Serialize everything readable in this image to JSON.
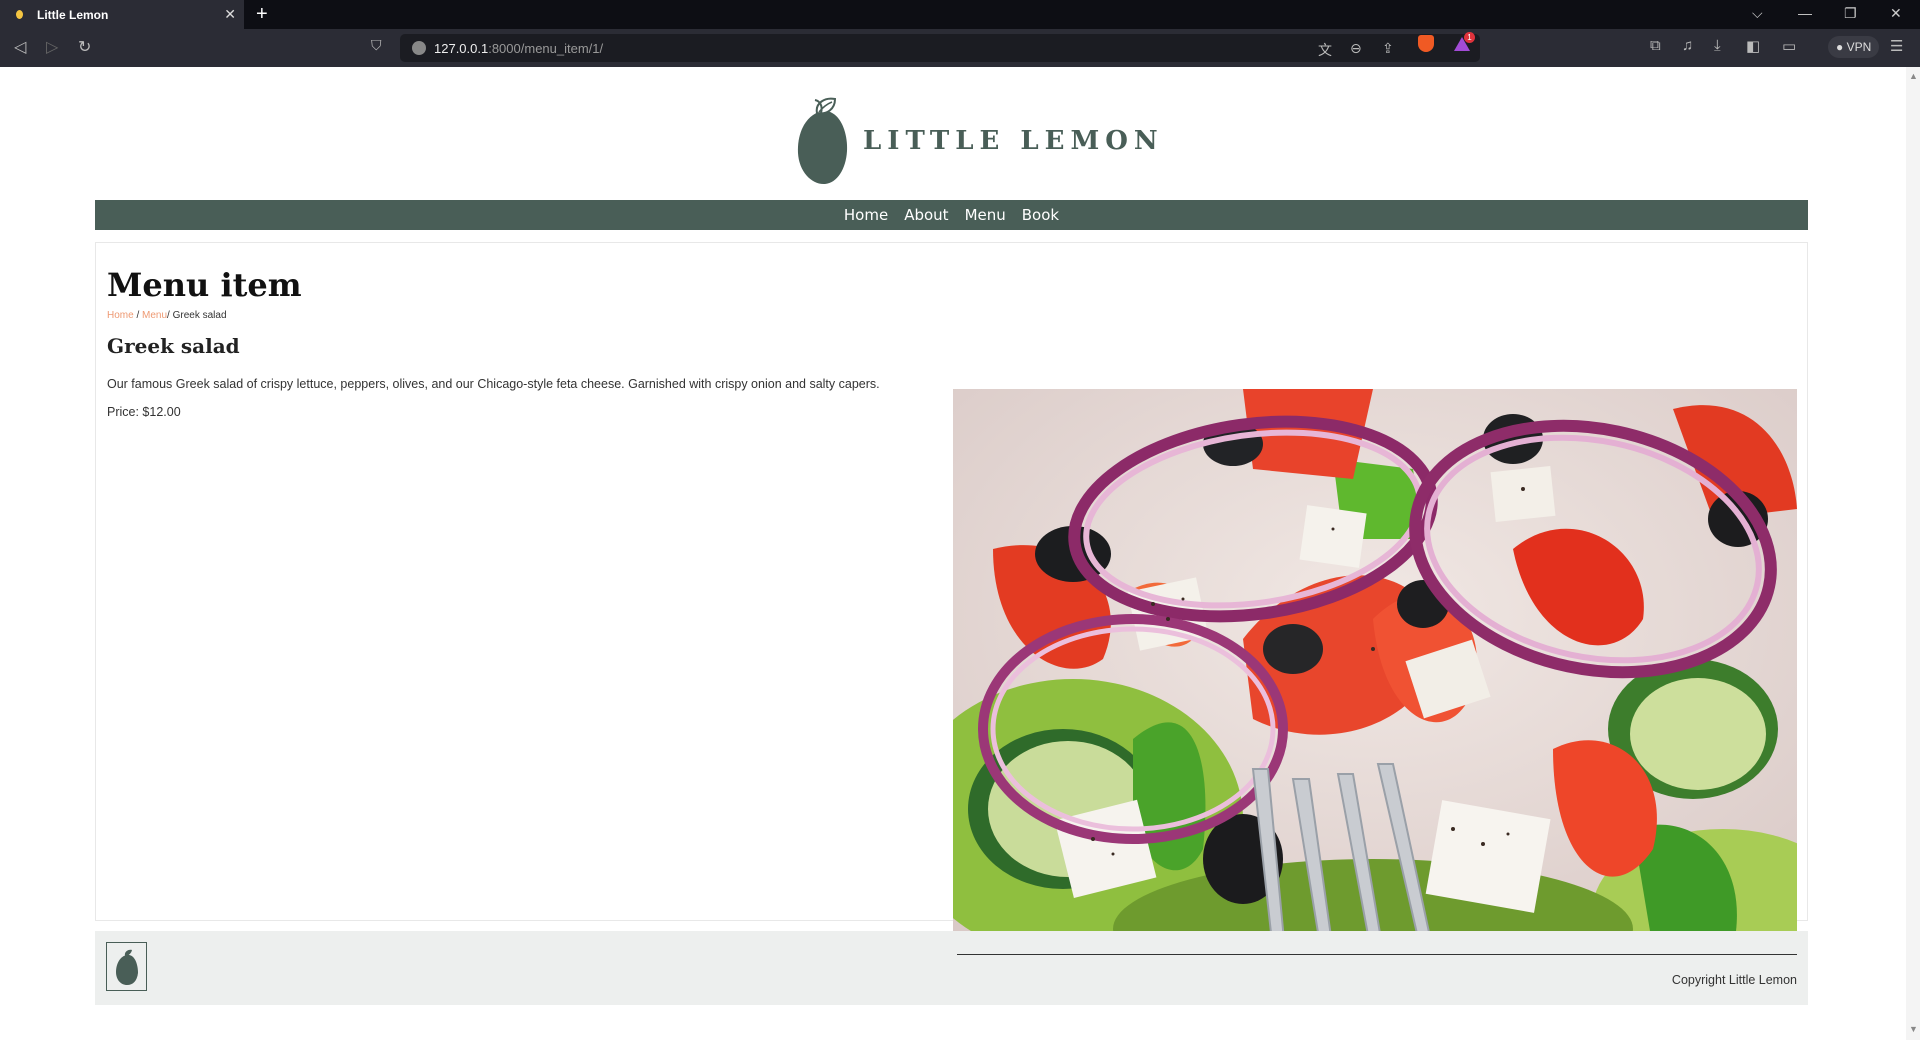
{
  "browser": {
    "tab_title": "Little Lemon",
    "tab_close": "✕",
    "new_tab": "+",
    "url_host": "127.0.0.1",
    "url_path": ":8000/menu_item/1/",
    "vpn_label": "VPN",
    "alert_count": "1"
  },
  "brand": {
    "name": "LITTLE LEMON",
    "primary_color": "#495e57",
    "accent_color": "#ee9972"
  },
  "nav": {
    "items": [
      {
        "label": "Home"
      },
      {
        "label": "About"
      },
      {
        "label": "Menu"
      },
      {
        "label": "Book"
      }
    ]
  },
  "page": {
    "title": "Menu item",
    "breadcrumb": {
      "home": "Home",
      "sep1": " / ",
      "menu": "Menu",
      "sep2": "/ ",
      "current": "Greek salad"
    }
  },
  "item": {
    "name": "Greek salad",
    "description": "Our famous Greek salad of crispy lettuce, peppers, olives, and our Chicago-style feta cheese. Garnished with crispy onion and salty capers.",
    "price_text": "Price: $12.00"
  },
  "footer": {
    "copyright": "Copyright Little Lemon"
  }
}
